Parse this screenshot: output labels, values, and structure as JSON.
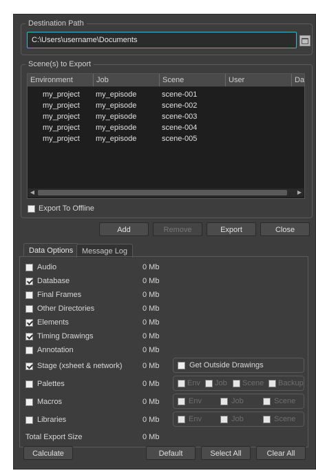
{
  "destination": {
    "title": "Destination Path",
    "path": "C:\\Users\\username\\Documents"
  },
  "scenes": {
    "title": "Scene(s) to Export",
    "columns": [
      "Environment",
      "Job",
      "Scene",
      "User",
      "Da"
    ],
    "rows": [
      {
        "env": "my_project",
        "job": "my_episode",
        "scene": "scene-001"
      },
      {
        "env": "my_project",
        "job": "my_episode",
        "scene": "scene-002"
      },
      {
        "env": "my_project",
        "job": "my_episode",
        "scene": "scene-003"
      },
      {
        "env": "my_project",
        "job": "my_episode",
        "scene": "scene-004"
      },
      {
        "env": "my_project",
        "job": "my_episode",
        "scene": "scene-005"
      }
    ],
    "export_offline": "Export To Offline"
  },
  "actions": {
    "add": "Add",
    "remove": "Remove",
    "export": "Export",
    "close": "Close"
  },
  "tabs": [
    "Data Options",
    "Message Log"
  ],
  "options": [
    {
      "label": "Audio",
      "checked": false,
      "size": "0 Mb"
    },
    {
      "label": "Database",
      "checked": true,
      "size": "0 Mb"
    },
    {
      "label": "Final Frames",
      "checked": false,
      "size": "0 Mb"
    },
    {
      "label": "Other Directories",
      "checked": false,
      "size": "0 Mb"
    },
    {
      "label": "Elements",
      "checked": true,
      "size": "0 Mb"
    },
    {
      "label": "Timing Drawings",
      "checked": true,
      "size": "0 Mb"
    },
    {
      "label": "Annotation",
      "checked": false,
      "size": "0 Mb"
    },
    {
      "label": "Stage (xsheet & network)",
      "checked": true,
      "size": "0 Mb"
    },
    {
      "label": "Palettes",
      "checked": false,
      "size": "0 Mb"
    },
    {
      "label": "Macros",
      "checked": false,
      "size": "0 Mb"
    },
    {
      "label": "Libraries",
      "checked": false,
      "size": "0 Mb"
    }
  ],
  "get_outside": "Get Outside Drawings",
  "sub_palettes": [
    "Env",
    "Job",
    "Scene",
    "Backup"
  ],
  "sub_macros": [
    "Env",
    "Job",
    "Scene"
  ],
  "sub_libraries": [
    "Env",
    "Job",
    "Scene"
  ],
  "total": {
    "label": "Total Export Size",
    "size": "0 Mb"
  },
  "bottom": {
    "calculate": "Calculate",
    "default": "Default",
    "select_all": "Select All",
    "clear_all": "Clear All"
  }
}
